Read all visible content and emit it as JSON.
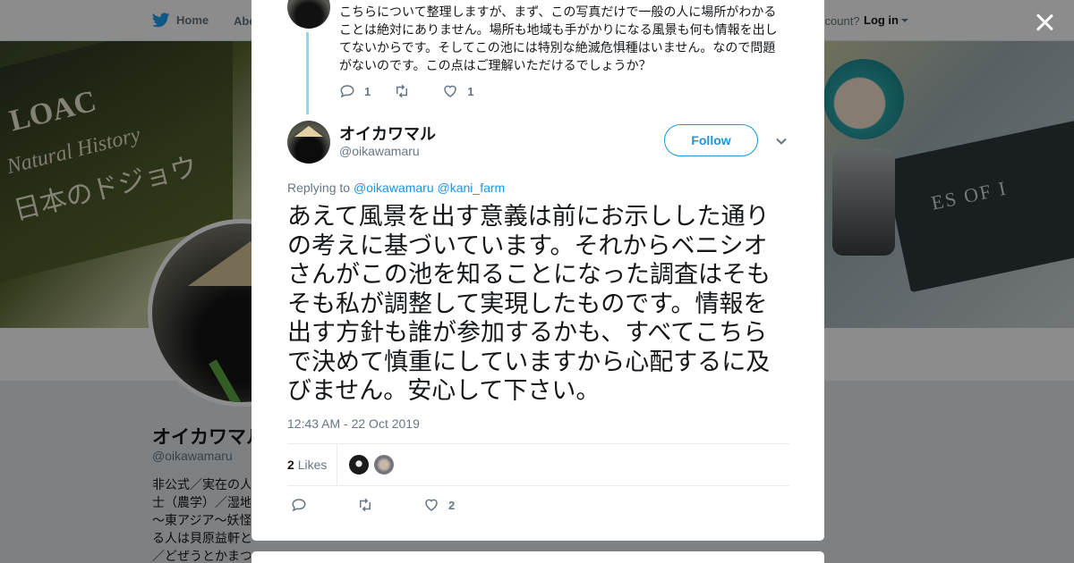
{
  "nav": {
    "home_label": "Home",
    "about_label": "Abo",
    "account_prompt": "ccount?",
    "login_label": "Log in"
  },
  "banner": {
    "book_title": "LOAC",
    "book_subtitle": "Natural History",
    "book_japanese": "日本のドジョウ",
    "card_text": "ES OF I"
  },
  "profile": {
    "name": "オイカワマル",
    "handle": "@oikawamaru",
    "bio_lines": [
      "非公式／実在の人",
      "士（農学）／湿地",
      "～東アジア～妖怪",
      "る人は貝原益軒と",
      "／どぜうとかまつ"
    ]
  },
  "previous_tweet": {
    "text": "こちらについて整理しますが、まず、この写真だけで一般の人に場所がわかることは絶対にありません。場所も地域も手がかりになる風景も何も情報を出してないからです。そしてこの池には特別な絶滅危惧種はいません。なので問題がないのです。この点はご理解いただけるでしょうか？",
    "reply_count": "1",
    "retweet_count": "",
    "like_count": "1"
  },
  "tweet": {
    "author_name": "オイカワマル",
    "author_handle": "@oikawamaru",
    "follow_label": "Follow",
    "replying_prefix": "Replying to",
    "replying_user1": "@oikawamaru",
    "replying_user2": "@kani_farm",
    "text": "あえて風景を出す意義は前にお示しした通りの考えに基づいています。それからベニシオさんがこの池を知ることになった調査はそもそも私が調整して実現したものです。情報を出す方針も誰が参加するかも、すべてこちらで決めて慎重にしていますから心配するに及びません。安心して下さい。",
    "timestamp": "12:43 AM - 22 Oct 2019",
    "likes_count": "2",
    "likes_label": "Likes",
    "like_action_count": "2"
  },
  "colors": {
    "link_blue": "#1b95e0",
    "thread_line": "#99d6df",
    "text_primary": "#14171a",
    "text_secondary": "#657786"
  },
  "icons": [
    "bird-icon",
    "close-icon",
    "reply-icon",
    "retweet-icon",
    "heart-icon",
    "chevron-down-icon"
  ]
}
